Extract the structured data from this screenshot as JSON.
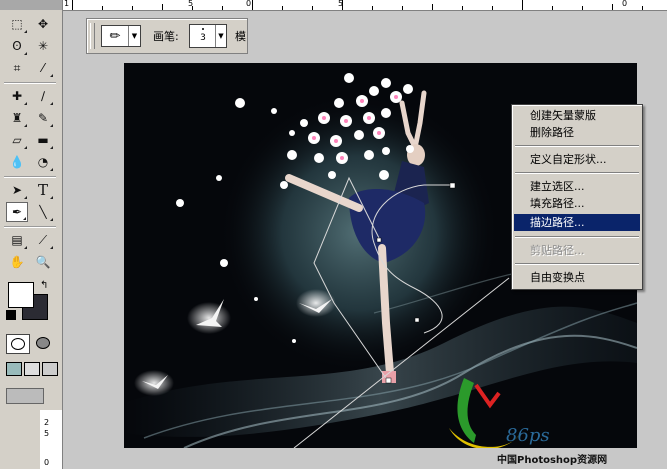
{
  "ruler": {
    "top_labels": [
      "1",
      "5",
      "0",
      "5",
      "0"
    ],
    "left_labels": [
      "2",
      "5",
      "0"
    ]
  },
  "options_bar": {
    "brush_label": "画笔:",
    "brush_size": "3",
    "mode_label_cut": "模"
  },
  "toolbox": {
    "tools": [
      "marquee-icon",
      "move-icon",
      "lasso-icon",
      "magic-wand-icon",
      "crop-icon",
      "slice-icon",
      "healing-brush-icon",
      "brush-icon",
      "clone-stamp-icon",
      "history-brush-icon",
      "eraser-icon",
      "gradient-icon",
      "blur-icon",
      "dodge-icon",
      "path-selection-icon",
      "type-icon",
      "pen-icon",
      "line-icon",
      "notes-icon",
      "eyedropper-icon",
      "hand-icon",
      "zoom-icon"
    ],
    "selected": "pen-icon"
  },
  "colors": {
    "foreground": "#ffffff",
    "background": "#2b2b33",
    "menu_highlight": "#0a246a"
  },
  "context_menu": {
    "items": [
      {
        "label": "创建矢量蒙版",
        "state": "normal"
      },
      {
        "label": "删除路径",
        "state": "normal"
      },
      {
        "label": "定义自定形状...",
        "state": "normal"
      },
      {
        "label": "建立选区...",
        "state": "normal"
      },
      {
        "label": "填充路径...",
        "state": "normal"
      },
      {
        "label": "描边路径...",
        "state": "highlighted"
      },
      {
        "label": "剪贴路径...",
        "state": "disabled"
      },
      {
        "label": "自由变换点",
        "state": "normal"
      }
    ]
  },
  "watermark": {
    "logo_text": "86ps",
    "site_text": "中国Photoshop资源网"
  }
}
